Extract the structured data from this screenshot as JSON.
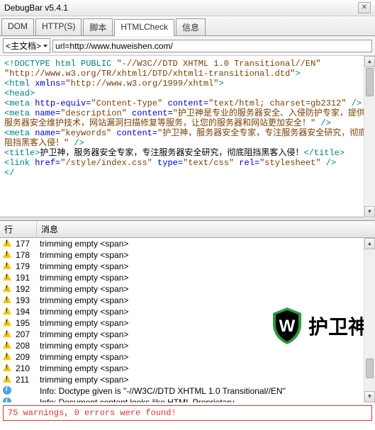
{
  "title": "DebugBar v5.4.1",
  "tabs": [
    {
      "label": "DOM",
      "active": false
    },
    {
      "label": "HTTP(S)",
      "active": false
    },
    {
      "label": "脚本",
      "active": false
    },
    {
      "label": "HTMLCheck",
      "active": true
    },
    {
      "label": "信息",
      "active": false
    }
  ],
  "urlbar": {
    "doc_label": "主文档",
    "url": "url=http://www.huweishen.com/"
  },
  "code_lines": [
    [
      {
        "c": "c-teal",
        "t": "<!DOCTYPE html PUBLIC "
      },
      {
        "c": "c-brown",
        "t": "\"-//W3C//DTD XHTML 1.0 Transitional//EN\""
      }
    ],
    [
      {
        "c": "c-brown",
        "t": "\"http://www.w3.org/TR/xhtml1/DTD/xhtml1-transitional.dtd\""
      },
      {
        "c": "c-teal",
        "t": ">"
      }
    ],
    [
      {
        "c": "c-teal",
        "t": "<html "
      },
      {
        "c": "c-blue",
        "t": "xmlns="
      },
      {
        "c": "c-brown",
        "t": "\"http://www.w3.org/1999/xhtml\""
      },
      {
        "c": "c-teal",
        "t": ">"
      }
    ],
    [
      {
        "c": "c-teal",
        "t": "<head>"
      }
    ],
    [
      {
        "c": "c-teal",
        "t": "<meta "
      },
      {
        "c": "c-blue",
        "t": "http-equiv="
      },
      {
        "c": "c-brown",
        "t": "\"Content-Type\""
      },
      {
        "c": "c-blue",
        "t": " content="
      },
      {
        "c": "c-brown",
        "t": "\"text/html; charset=gb2312\""
      },
      {
        "c": "c-teal",
        "t": " />"
      }
    ],
    [
      {
        "c": "c-teal",
        "t": "<meta "
      },
      {
        "c": "c-blue",
        "t": "name="
      },
      {
        "c": "c-brown",
        "t": "\"description\""
      },
      {
        "c": "c-blue",
        "t": " content="
      },
      {
        "c": "c-brown",
        "t": "\"护卫神是专业的服务器安全、入侵防护专家，提供服务器安全维护技术，网站漏洞扫描修复等服务，让您的服务器和网站更加安全！\""
      },
      {
        "c": "c-teal",
        "t": " />"
      }
    ],
    [
      {
        "c": "c-teal",
        "t": "<meta "
      },
      {
        "c": "c-blue",
        "t": "name="
      },
      {
        "c": "c-brown",
        "t": "\"keywords\""
      },
      {
        "c": "c-blue",
        "t": " content="
      },
      {
        "c": "c-brown",
        "t": "\"护卫神，服务器安全专家，专注服务器安全研究，彻底阻挡黑客入侵！\""
      },
      {
        "c": "c-teal",
        "t": " />"
      }
    ],
    [
      {
        "c": "c-teal",
        "t": "<title>"
      },
      {
        "c": "c-black",
        "t": "护卫神，服务器安全专家，专注服务器安全研究，彻底阻挡黑客入侵！"
      },
      {
        "c": "c-teal",
        "t": "</title>"
      }
    ],
    [
      {
        "c": "c-teal",
        "t": "<link "
      },
      {
        "c": "c-blue",
        "t": "href="
      },
      {
        "c": "c-brown",
        "t": "\"/style/index.css\""
      },
      {
        "c": "c-blue",
        "t": " type="
      },
      {
        "c": "c-brown",
        "t": "\"text/css\""
      },
      {
        "c": "c-blue",
        "t": " rel="
      },
      {
        "c": "c-brown",
        "t": "\"stylesheet\""
      },
      {
        "c": "c-teal",
        "t": " />"
      }
    ],
    [
      {
        "c": "c-teal",
        "t": "</"
      }
    ]
  ],
  "messages": {
    "header_line": "行",
    "header_msg": "消息",
    "rows": [
      {
        "type": "warn",
        "line": "177",
        "text": "trimming empty  <span>"
      },
      {
        "type": "warn",
        "line": "178",
        "text": "trimming empty  <span>"
      },
      {
        "type": "warn",
        "line": "179",
        "text": "trimming empty  <span>"
      },
      {
        "type": "warn",
        "line": "191",
        "text": "trimming empty  <span>"
      },
      {
        "type": "warn",
        "line": "192",
        "text": "trimming empty  <span>"
      },
      {
        "type": "warn",
        "line": "193",
        "text": "trimming empty  <span>"
      },
      {
        "type": "warn",
        "line": "194",
        "text": "trimming empty  <span>"
      },
      {
        "type": "warn",
        "line": "195",
        "text": "trimming empty  <span>"
      },
      {
        "type": "warn",
        "line": "207",
        "text": "trimming empty  <span>"
      },
      {
        "type": "warn",
        "line": "208",
        "text": "trimming empty  <span>"
      },
      {
        "type": "warn",
        "line": "209",
        "text": "trimming empty  <span>"
      },
      {
        "type": "warn",
        "line": "210",
        "text": "trimming empty  <span>"
      },
      {
        "type": "warn",
        "line": "211",
        "text": "trimming empty  <span>"
      },
      {
        "type": "info",
        "line": "",
        "text": "Info: Doctype given is \"-//W3C//DTD XHTML 1.0 Transitional//EN\""
      },
      {
        "type": "info",
        "line": "",
        "text": "Info: Document content looks like HTML Proprietary"
      },
      {
        "type": "info",
        "line": "",
        "text": "75 warnings, 0 errors were found!",
        "selected": true
      }
    ]
  },
  "summary": "75 warnings, 0 errors were found!",
  "watermark": "护卫神"
}
